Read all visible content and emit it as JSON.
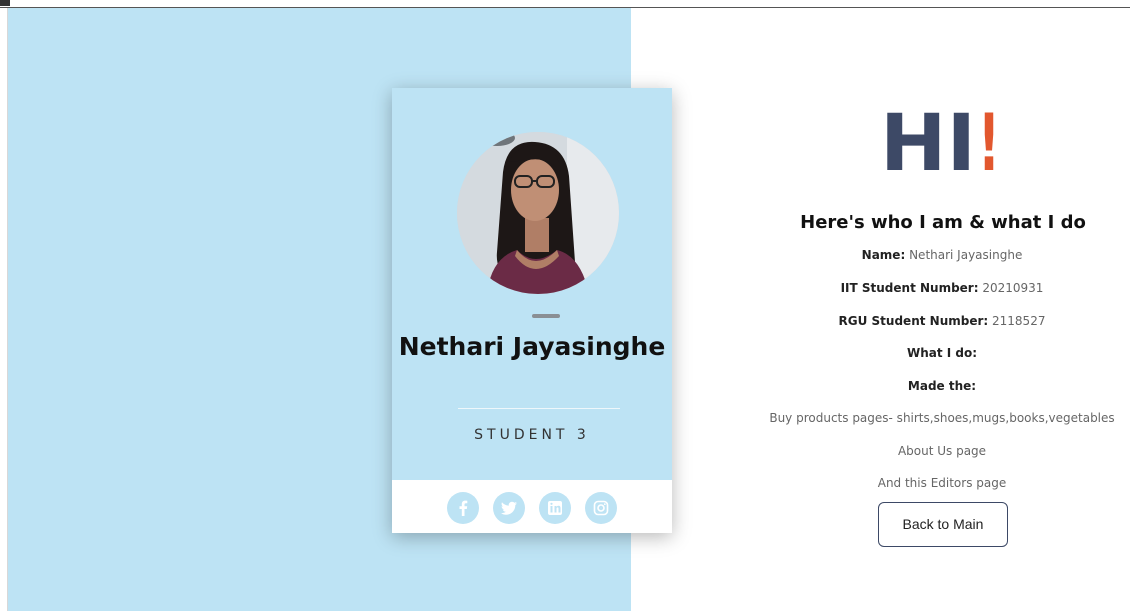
{
  "card": {
    "name": "Nethari Jayasinghe",
    "role": "STUDENT 3",
    "social": [
      "facebook-icon",
      "twitter-icon",
      "linkedin-icon",
      "instagram-icon"
    ]
  },
  "greeting": {
    "hi": "HI",
    "exclaim": "!"
  },
  "about": {
    "title": "Here's who I am & what I do",
    "name_label": "Name:",
    "name_value": "Nethari Jayasinghe",
    "iit_label": "IIT Student Number:",
    "iit_value": "20210931",
    "rgu_label": "RGU Student Number:",
    "rgu_value": "2118527",
    "what_label": "What I do:",
    "made_label": "Made the:",
    "work_items": [
      "Buy products pages- shirts,shoes,mugs,books,vegetables",
      "About Us page",
      "And this Editors page"
    ]
  },
  "buttons": {
    "back": "Back to Main"
  },
  "colors": {
    "panel": "#bde3f4",
    "hi_text": "#3d4966",
    "exclaim": "#e2572e",
    "social": "#bde3f4"
  }
}
